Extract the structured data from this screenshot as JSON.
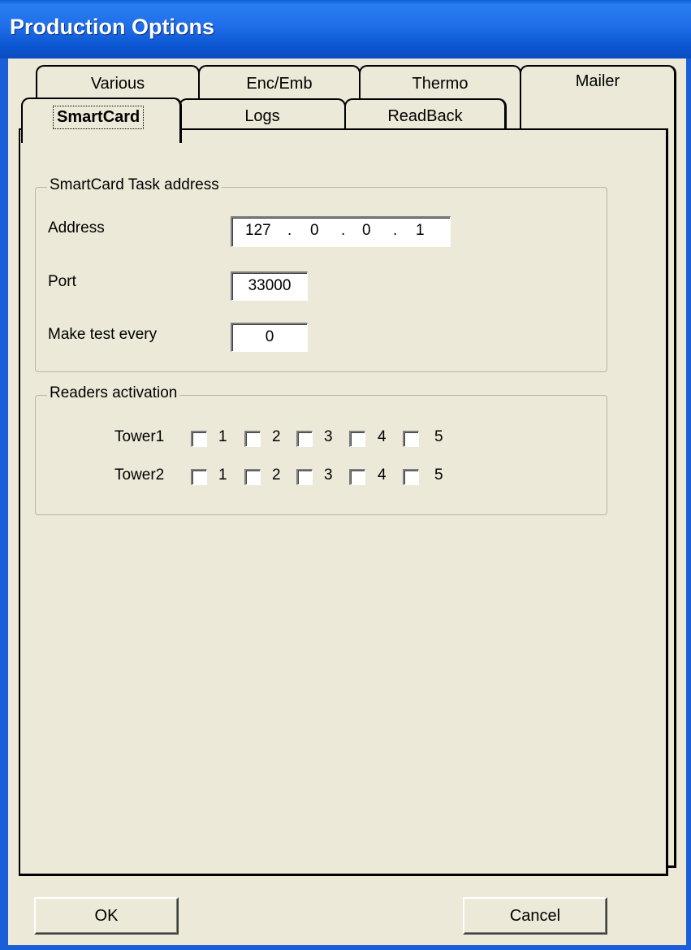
{
  "window": {
    "title": "Production Options"
  },
  "tabs": {
    "row1": [
      "Various",
      "Enc/Emb",
      "Thermo",
      "Mailer"
    ],
    "row2": [
      "SmartCard",
      "Logs",
      "ReadBack"
    ],
    "selected": "SmartCard"
  },
  "smartcard_task": {
    "group_title": "SmartCard Task address",
    "address_label": "Address",
    "address": [
      "127",
      "0",
      "0",
      "1"
    ],
    "ip_separator": ".",
    "port_label": "Port",
    "port_value": "33000",
    "test_label": "Make test every",
    "test_value": "0"
  },
  "readers": {
    "group_title": "Readers activation",
    "towers": [
      {
        "label": "Tower1",
        "readers": [
          "1",
          "2",
          "3",
          "4",
          "5"
        ],
        "checked": [
          false,
          false,
          false,
          false,
          false
        ]
      },
      {
        "label": "Tower2",
        "readers": [
          "1",
          "2",
          "3",
          "4",
          "5"
        ],
        "checked": [
          false,
          false,
          false,
          false,
          false
        ]
      }
    ]
  },
  "buttons": {
    "ok": "OK",
    "cancel": "Cancel"
  }
}
